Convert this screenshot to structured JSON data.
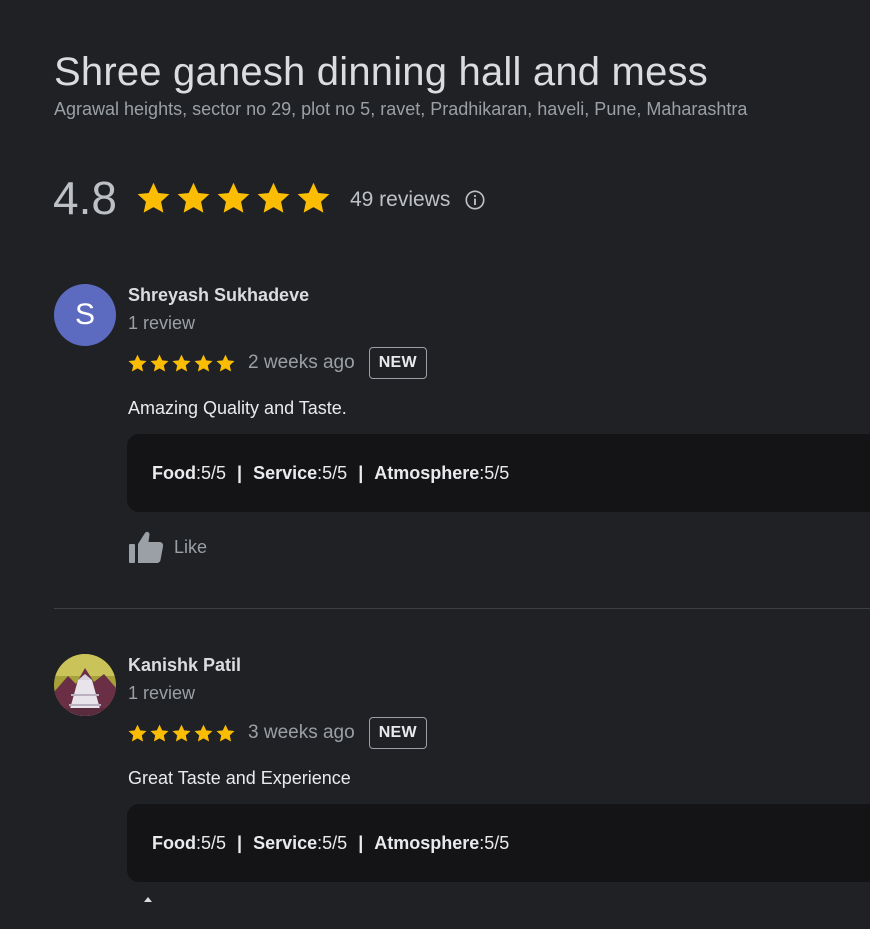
{
  "place": {
    "name": "Shree ganesh dinning hall and mess",
    "address": "Agrawal heights, sector no 29, plot no 5, ravet, Pradhikaran, haveli, Pune, Maharashtra",
    "rating": "4.8",
    "stars": 5,
    "review_count": "49 reviews",
    "star_color": "#fbbc04"
  },
  "reviews": [
    {
      "name": "Shreyash Sukhadeve",
      "avatar_letter": "S",
      "avatar_color": "#5c6bc0",
      "meta": "1 review",
      "stars": 5,
      "date": "2 weeks ago",
      "badge": "NEW",
      "text": "Amazing Quality and Taste.",
      "attributes": [
        {
          "label": "Food",
          "value": "5/5"
        },
        {
          "label": "Service",
          "value": "5/5"
        },
        {
          "label": "Atmosphere",
          "value": "5/5"
        }
      ],
      "like_label": "Like"
    },
    {
      "name": "Kanishk Patil",
      "avatar_letter": "",
      "meta": "1 review",
      "stars": 5,
      "date": "3 weeks ago",
      "badge": "NEW",
      "text": "Great Taste and Experience",
      "attributes": [
        {
          "label": "Food",
          "value": "5/5"
        },
        {
          "label": "Service",
          "value": "5/5"
        },
        {
          "label": "Atmosphere",
          "value": "5/5"
        }
      ]
    }
  ],
  "attr_separator": "|",
  "icons": {
    "star": "star-icon",
    "info": "info-icon",
    "like": "thumbs-up-icon"
  }
}
